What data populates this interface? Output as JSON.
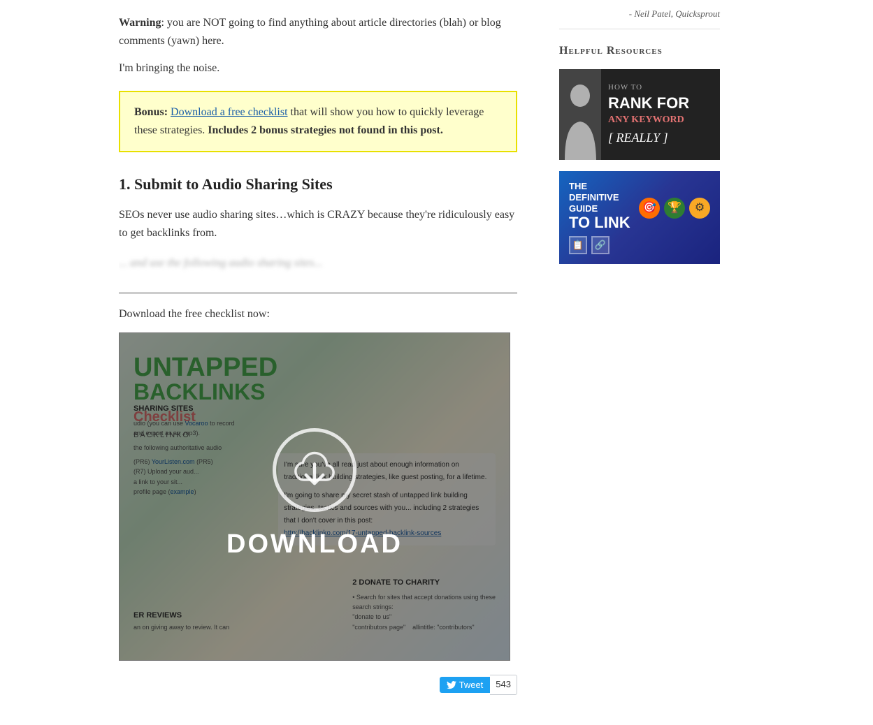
{
  "main": {
    "warning_label": "Warning",
    "warning_text": ": you are NOT going to find anything about article directories (blah) or blog comments (yawn) here.",
    "intro_text": "I'm bringing the noise.",
    "bonus_label": "Bonus: ",
    "bonus_link_text": "Download a free checklist",
    "bonus_after": " that will show you how to quickly leverage these strategies. ",
    "bonus_bold": "Includes 2 bonus strategies not found in this post.",
    "section1_heading": "1. Submit to Audio Sharing Sites",
    "section1_intro": "SEOs never use audio sharing sites…which is CRAZY because they're ridiculously easy to get backlinks from.",
    "blurred_text": "... and use the following audio sharing sites...",
    "download_prompt": "Download the free checklist now:",
    "download_label": "DOWNLOAD",
    "checklist_untapped": "UNTAPPED",
    "checklist_backlinks": "BACKLINKS",
    "checklist_checklist": "Checklist",
    "checklist_brand": "BACKLINKO",
    "tweet_label": "Tweet",
    "tweet_count": "543"
  },
  "sidebar": {
    "quote": "- Neil Patel, Quicksprout",
    "helpful_resources_heading": "Helpful Resources",
    "card1": {
      "line1": "HOW TO",
      "line2": "RANK FOR",
      "line3": "ANY KEYWORD",
      "line4": "[ REALLY ]"
    },
    "card2": {
      "line1": "THE DEFINITIVE GUIDE",
      "line2": "To LINK",
      "icons": [
        "🎯",
        "🏆",
        "⚙"
      ]
    }
  }
}
